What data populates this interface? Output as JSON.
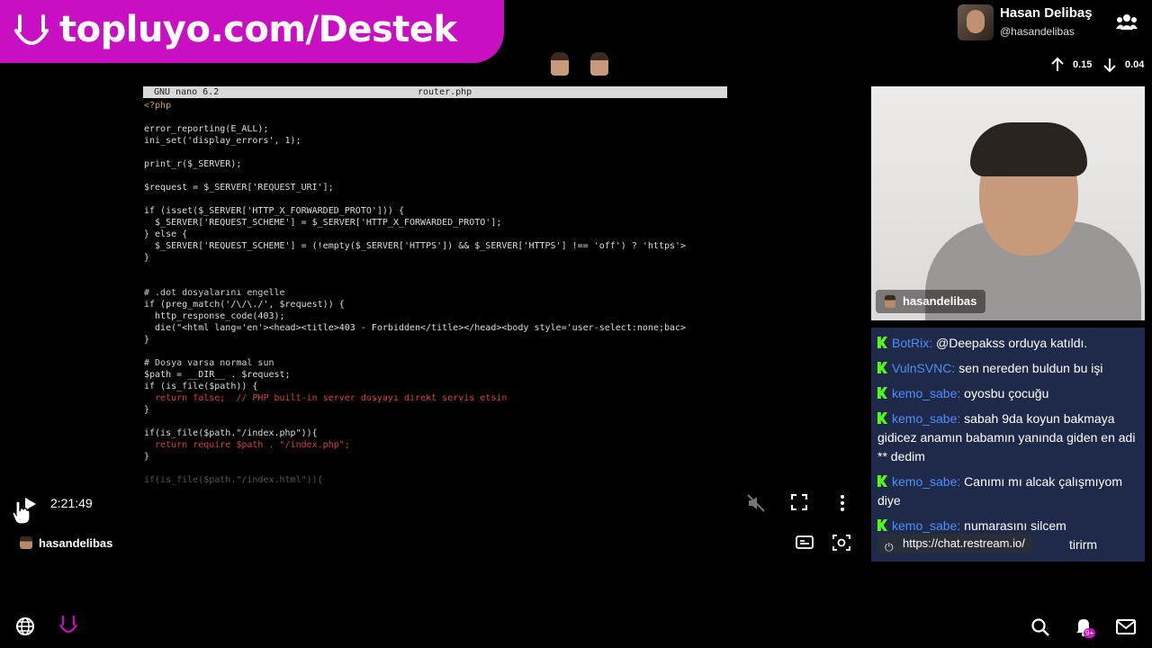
{
  "banner": {
    "text": "topluyo.com/Destek"
  },
  "profile": {
    "name": "Hasan Delibaş",
    "handle": "@hasandelibas"
  },
  "stats": {
    "up": "0.15",
    "down": "0.04"
  },
  "editor": {
    "app": "GNU nano 6.2",
    "file": "router.php",
    "lines": [
      "<?php",
      "",
      "error_reporting(E_ALL);",
      "ini_set('display_errors', 1);",
      "",
      "print_r($_SERVER);",
      "",
      "$request = $_SERVER['REQUEST_URI'];",
      "",
      "if (isset($_SERVER['HTTP_X_FORWARDED_PROTO'])) {",
      "  $_SERVER['REQUEST_SCHEME'] = $_SERVER['HTTP_X_FORWARDED_PROTO'];",
      "} else {",
      "  $_SERVER['REQUEST_SCHEME'] = (!empty($_SERVER['HTTPS']) && $_SERVER['HTTPS'] !== 'off') ? 'https'>",
      "}",
      "",
      "",
      "# .dot dosyalarını engelle",
      "if (preg_match('/\\/\\./', $request)) {",
      "  http_response_code(403);",
      "  die(\"<html lang='en'><head><title>403 - Forbidden</title></head><body style='user-select:none;bac>",
      "}",
      "",
      "# Dosya varsa normal sun",
      "$path = __DIR__ . $request;",
      "if (is_file($path)) {",
      "  return false;  // PHP built-in server dosyayı direkt servis etsin",
      "}",
      "",
      "if(is_file($path.\"/index.php\")){",
      "  return require $path . \"/index.php\";",
      "}",
      "",
      "if(is_file($path.\"/index.html\")){"
    ]
  },
  "player": {
    "time": "2:21:49",
    "channel": "hasandelibas"
  },
  "webcam": {
    "tag": "hasandelibas"
  },
  "chat": {
    "messages": [
      {
        "user": "BotRix:",
        "text": "@Deepakss orduya katıldı."
      },
      {
        "user": "VulnSVNC:",
        "text": "sen nereden buldun bu işi"
      },
      {
        "user": "kemo_sabe:",
        "text": "oyosbu çocuğu"
      },
      {
        "user": "kemo_sabe:",
        "text": "sabah 9da koyun bakmaya gidicez anamın babamın yanında giden en adi ** dedim"
      },
      {
        "user": "kemo_sabe:",
        "text": "Canımı mı alcak çalışmıyom diye"
      },
      {
        "user": "kemo_sabe:",
        "text": "numarasını silcem"
      }
    ],
    "trailing_fragment": "tirirm",
    "link": "https://chat.restream.io/"
  },
  "badges": {
    "notifications": "9+"
  },
  "colors": {
    "brand": "#c80fc2",
    "chat_bg": "#1f2a4a",
    "kick_green": "#53fc18",
    "username": "#4e8ef7"
  }
}
